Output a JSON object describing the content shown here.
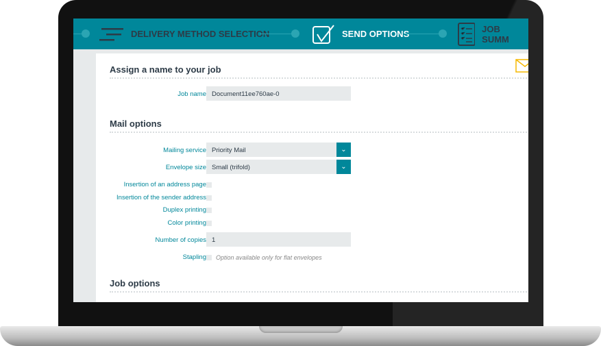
{
  "steps": [
    {
      "label": "DELIVERY METHOD SELECTION",
      "icon": "menu-lines-icon"
    },
    {
      "label": "SEND OPTIONS",
      "icon": "checkbox-checked-icon",
      "active": true
    },
    {
      "label": "JOB SUMM",
      "icon": "checklist-icon"
    }
  ],
  "sections": {
    "job_name": "Assign a name to your job",
    "mail": "Mail options",
    "job": "Job options"
  },
  "fields": {
    "job_name": {
      "label": "Job name",
      "value": "Document11ee760ae-0"
    },
    "mailing_service": {
      "label": "Mailing service",
      "value": "Priority Mail"
    },
    "envelope_size": {
      "label": "Envelope size",
      "value": "Small (trifold)"
    },
    "address_page": {
      "label": "Insertion of an address page",
      "checked": false
    },
    "sender_address": {
      "label": "Insertion of the sender address",
      "checked": false
    },
    "duplex": {
      "label": "Duplex printing",
      "checked": false
    },
    "color": {
      "label": "Color printing",
      "checked": false
    },
    "copies": {
      "label": "Number of copies",
      "value": "1"
    },
    "stapling": {
      "label": "Stapling",
      "checked": false,
      "note": "Option available only for flat envelopes"
    }
  },
  "colors": {
    "accent": "#00879a",
    "heading": "#2d3b47",
    "envelope": "#f5b800"
  }
}
